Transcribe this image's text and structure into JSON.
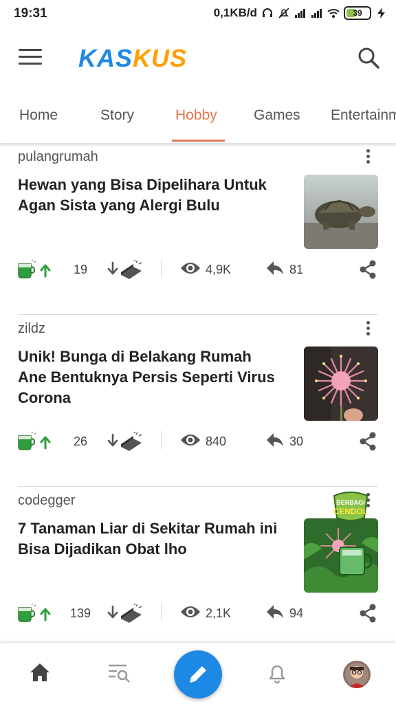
{
  "status_bar": {
    "time": "19:31",
    "network_speed": "0,1KB/d",
    "battery": "39",
    "icons": [
      "headset-icon",
      "silent-icon",
      "signal-icon",
      "signal-icon",
      "wifi-icon",
      "battery-icon",
      "charging-icon"
    ]
  },
  "header": {
    "logo_part1": "KAS",
    "logo_part2": "KUS",
    "colors": {
      "brand_blue": "#1e88e5",
      "brand_orange": "#ffa000"
    }
  },
  "tabs": {
    "items": [
      {
        "label": "Home"
      },
      {
        "label": "Story"
      },
      {
        "label": "Hobby"
      },
      {
        "label": "Games"
      },
      {
        "label": "Entertainm"
      }
    ],
    "active": "Hobby",
    "accent": "#e2764b"
  },
  "feed": {
    "cards": [
      {
        "author": "pulangrumah",
        "title": "Hewan yang Bisa Dipelihara Untuk Agan Sista yang Alergi Bulu",
        "cendol": "19",
        "views": "4,9K",
        "replies": "81",
        "thumbnail": "tortoise-photo"
      },
      {
        "author": "zildz",
        "title": "Unik! Bunga di Belakang Rumah Ane Bentuknya Persis Seperti Virus Corona",
        "cendol": "26",
        "views": "840",
        "replies": "30",
        "thumbnail": "pink-flower-photo"
      },
      {
        "author": "codegger",
        "title": "7 Tanaman Liar di Sekitar Rumah ini Bisa Dijadikan Obat lho",
        "cendol": "139",
        "views": "2,1K",
        "replies": "94",
        "thumbnail": "berbagi-cendol-promo",
        "badge_line1": "BERBAGI",
        "badge_line2": "CENDOL"
      }
    ]
  },
  "bottom_nav": {
    "items": [
      "home-icon",
      "search-list-icon",
      "pencil-icon",
      "bell-icon",
      "avatar"
    ]
  }
}
